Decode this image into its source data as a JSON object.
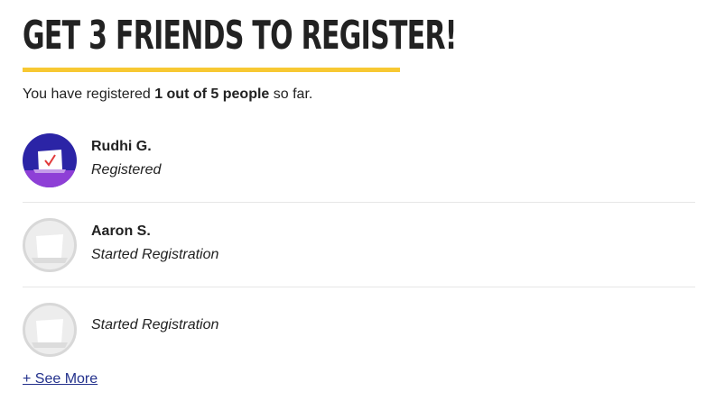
{
  "header": {
    "title": "GET 3 FRIENDS TO REGISTER!"
  },
  "summary": {
    "prefix": "You have registered ",
    "highlight": "1 out of 5 people",
    "suffix": " so far."
  },
  "friends": [
    {
      "name": "Rudhi G.",
      "status": "Registered",
      "avatar": "registered-ballot-icon"
    },
    {
      "name": "Aaron S.",
      "status": "Started Registration",
      "avatar": "ballot-placeholder-icon"
    },
    {
      "name": "",
      "status": "Started Registration",
      "avatar": "ballot-placeholder-icon"
    }
  ],
  "see_more_label": "+ See More",
  "colors": {
    "accent": "#f7c832",
    "avatar_registered": "#2b24a6",
    "link": "#23318c"
  }
}
